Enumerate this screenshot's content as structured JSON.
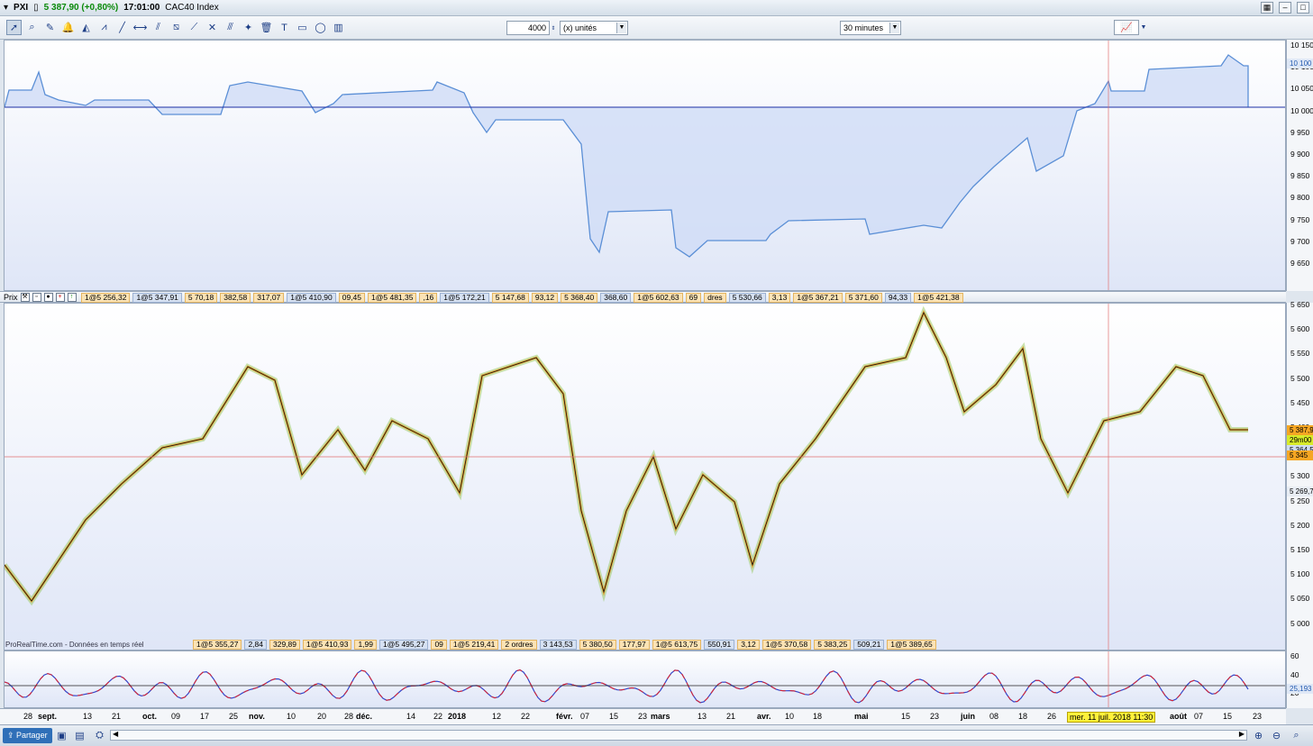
{
  "titlebar": {
    "symbol": "PXI",
    "price_change": "5 387,90 (+0,80%)",
    "time": "17:01:00",
    "instrument": "CAC40 Index"
  },
  "toolbar": {
    "quantity": "4000",
    "unit": "(x) unités",
    "timeframe": "30 minutes"
  },
  "equity_axis": [
    "10 150",
    "10 100",
    "10 050",
    "10 000",
    "9 950",
    "9 900",
    "9 850",
    "9 800",
    "9 750",
    "9 700",
    "9 650"
  ],
  "equity_tag": "10 100",
  "price_axis": [
    "5 650",
    "5 600",
    "5 550",
    "5 500",
    "5 450",
    "5 400",
    "5 350",
    "5 300",
    "5 250",
    "5 200",
    "5 150",
    "5 100",
    "5 050",
    "5 000"
  ],
  "price_tags": {
    "last": "5 387,9",
    "volume": "29m00",
    "small": "5 364,5",
    "cross": "5 345",
    "low": "5 269,7"
  },
  "osc_axis": [
    "60",
    "40",
    "20"
  ],
  "osc_tag": "25,193",
  "pricebar_label": "Prix",
  "orders_top": [
    "1@5 256,32",
    "1@5 347,91",
    "5 70,18",
    "382,58",
    "317,07",
    "1@5 410,90",
    "09,45",
    "1@5 481,35",
    ",16",
    "1@5 172,21",
    "5 147,68",
    "93,12",
    "5 368,40",
    "368,60",
    "1@5 602,63",
    "69",
    "dres",
    "5 530,66",
    "3,13",
    "1@5 367,21",
    "5 371,60",
    "94,33",
    "1@5 421,38"
  ],
  "orders_bottom": [
    "1@5 355,27",
    "2,84",
    "329,89",
    "1@5 410,93",
    "1,99",
    "1@5 495,27",
    "09",
    "1@5 219,41",
    "2 ordres",
    "3 143,53",
    "5 380,50",
    "177,97",
    "1@5 613,75",
    "550,91",
    "3,12",
    "1@5 370,58",
    "5 383,25",
    "509,21",
    "1@5 389,65"
  ],
  "watermark": "ProRealTime.com - Données en temps réel",
  "xaxis": [
    {
      "label": "28",
      "major": false
    },
    {
      "label": "sept.",
      "major": true
    },
    {
      "label": "13",
      "major": false
    },
    {
      "label": "21",
      "major": false
    },
    {
      "label": "oct.",
      "major": true
    },
    {
      "label": "09",
      "major": false
    },
    {
      "label": "17",
      "major": false
    },
    {
      "label": "25",
      "major": false
    },
    {
      "label": "nov.",
      "major": true
    },
    {
      "label": "10",
      "major": false
    },
    {
      "label": "20",
      "major": false
    },
    {
      "label": "28",
      "major": false
    },
    {
      "label": "déc.",
      "major": true
    },
    {
      "label": "14",
      "major": false
    },
    {
      "label": "22",
      "major": false
    },
    {
      "label": "2018",
      "major": true
    },
    {
      "label": "12",
      "major": false
    },
    {
      "label": "22",
      "major": false
    },
    {
      "label": "févr.",
      "major": true
    },
    {
      "label": "07",
      "major": false
    },
    {
      "label": "15",
      "major": false
    },
    {
      "label": "23",
      "major": false
    },
    {
      "label": "mars",
      "major": true
    },
    {
      "label": "13",
      "major": false
    },
    {
      "label": "21",
      "major": false
    },
    {
      "label": "avr.",
      "major": true
    },
    {
      "label": "10",
      "major": false
    },
    {
      "label": "18",
      "major": false
    },
    {
      "label": "mai",
      "major": true
    },
    {
      "label": "15",
      "major": false
    },
    {
      "label": "23",
      "major": false
    },
    {
      "label": "juin",
      "major": true
    },
    {
      "label": "08",
      "major": false
    },
    {
      "label": "18",
      "major": false
    },
    {
      "label": "26",
      "major": false
    },
    {
      "label": "août",
      "major": true
    },
    {
      "label": "07",
      "major": false
    },
    {
      "label": "15",
      "major": false
    },
    {
      "label": "23",
      "major": false
    }
  ],
  "crosshair_date": "mer. 11 juil. 2018 11:30",
  "bottombar": {
    "share": "Partager"
  },
  "colors": {
    "equity_line": "#5b8fd6",
    "equity_up_fill": "#b7cff2",
    "equity_down_fill": "#f8c99a",
    "equity_down_line": "#f0a040",
    "osc_red": "#e0202a",
    "osc_blue": "#3546c8"
  }
}
